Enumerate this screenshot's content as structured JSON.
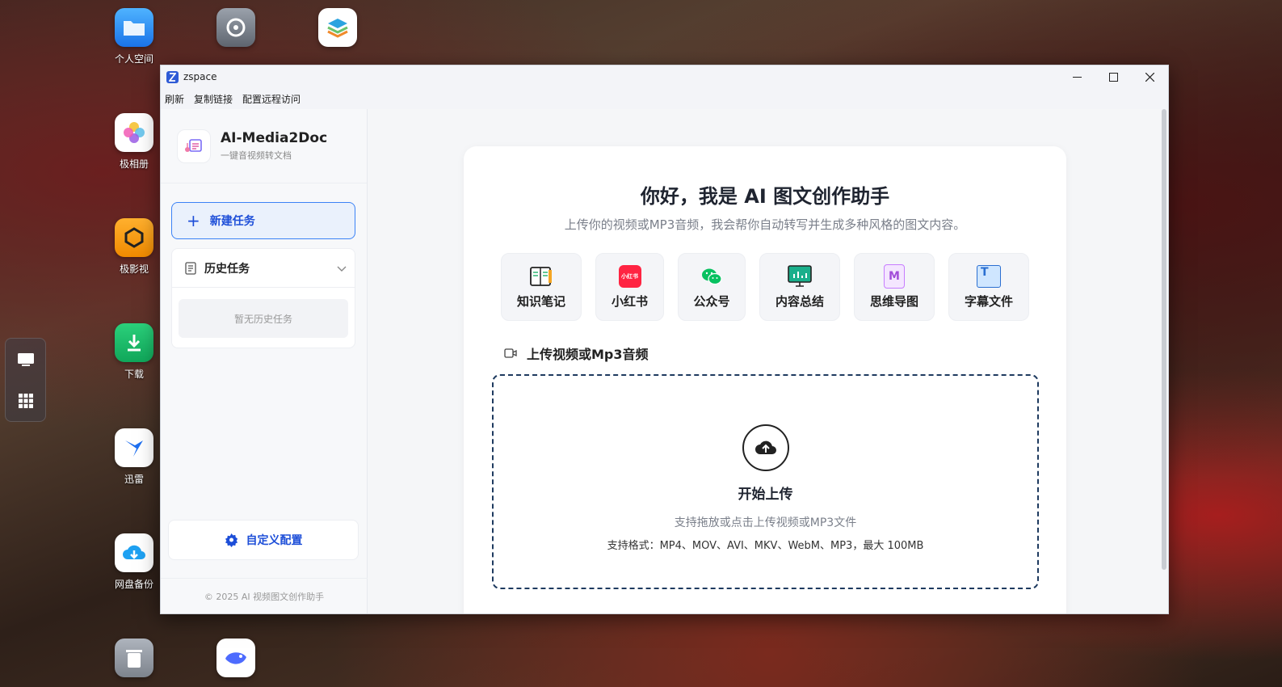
{
  "desktop": {
    "icons": [
      {
        "id": "personal-space",
        "label": "个人空间"
      },
      {
        "id": "settings",
        "label": ""
      },
      {
        "id": "layers",
        "label": ""
      },
      {
        "id": "photos",
        "label": "极相册"
      },
      {
        "id": "video",
        "label": "极影视"
      },
      {
        "id": "download",
        "label": "下载"
      },
      {
        "id": "xunlei",
        "label": "迅雷"
      },
      {
        "id": "backup",
        "label": "网盘备份"
      }
    ]
  },
  "window": {
    "title": "zspace",
    "menu": [
      "刷新",
      "复制链接",
      "配置远程访问"
    ]
  },
  "sidebar": {
    "app_name": "AI-Media2Doc",
    "app_tagline": "一键音视频转文档",
    "new_task_label": "新建任务",
    "history_label": "历史任务",
    "history_empty": "暂无历史任务",
    "custom_config_label": "自定义配置",
    "copyright": "© 2025 AI 视频图文创作助手"
  },
  "main": {
    "title": "你好，我是 AI 图文创作助手",
    "subtitle": "上传你的视频或MP3音频，我会帮你自动转写并生成多种风格的图文内容。",
    "styles": [
      {
        "label": "知识笔记",
        "icon": "notebook-icon"
      },
      {
        "label": "小红书",
        "icon": "xiaohongshu-icon",
        "badge": "小红书"
      },
      {
        "label": "公众号",
        "icon": "wechat-icon"
      },
      {
        "label": "内容总结",
        "icon": "monitor-chart-icon"
      },
      {
        "label": "思维导图",
        "icon": "mindmap-icon",
        "badge": "M"
      },
      {
        "label": "字幕文件",
        "icon": "subtitle-icon",
        "badge": "T"
      }
    ],
    "upload_header": "上传视频或Mp3音频",
    "upload_start": "开始上传",
    "upload_hint": "支持拖放或点击上传视频或MP3文件",
    "upload_formats": "支持格式：MP4、MOV、AVI、MKV、WebM、MP3，最大 100MB"
  },
  "colors": {
    "accent": "#1d4ed8",
    "accent_border": "#3b82f6",
    "dropzone_border": "#1e3a5f"
  }
}
